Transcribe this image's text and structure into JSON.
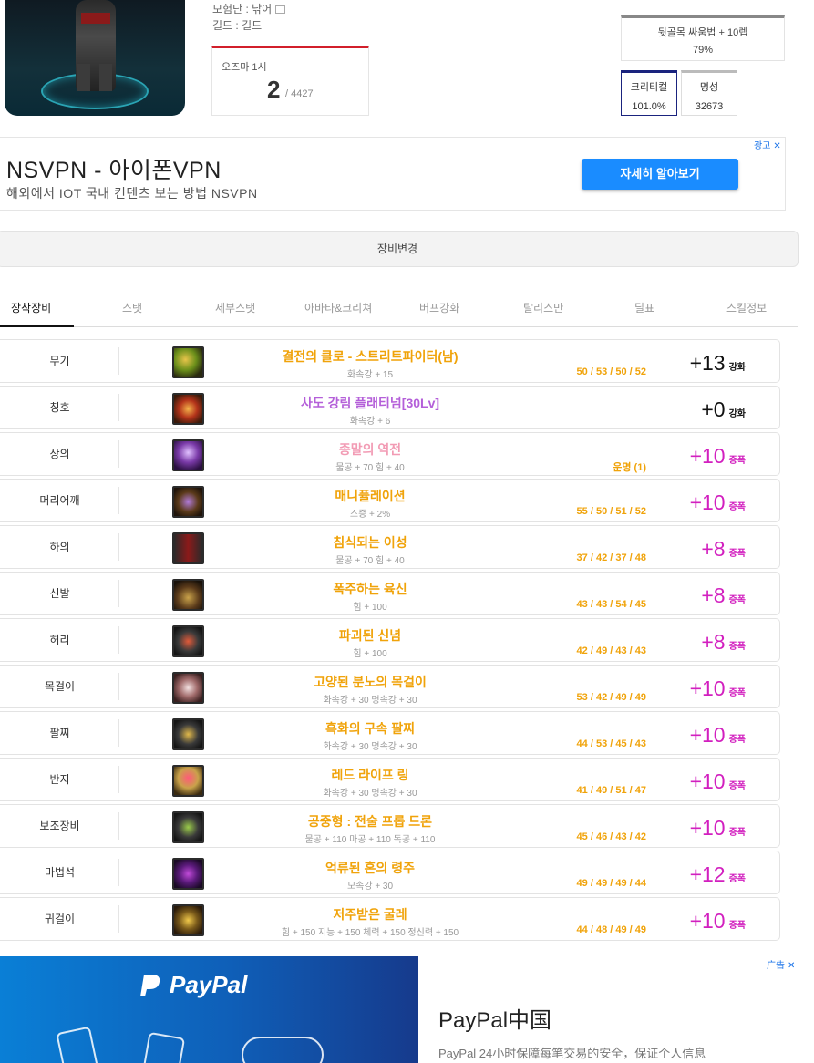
{
  "profile": {
    "adventure_label": "모험단 : 낚어",
    "guild_label": "길드 : 길드",
    "rank": {
      "label": "오즈마 1시",
      "value": "2",
      "total": "/ 4427"
    },
    "buff": {
      "title": "뒷골목 싸움법 + 10렙",
      "value": "79%"
    },
    "critical": {
      "title": "크리티컬",
      "value": "101.0%"
    },
    "fame": {
      "title": "명성",
      "value": "32673"
    }
  },
  "ad_top": {
    "title": "NSVPN - 아이폰VPN",
    "subtitle": "해외에서 IOT 국내 컨텐츠 보는 방법 NSVPN",
    "cta": "자세히 알아보기",
    "badge": "광고"
  },
  "change_button": "장비변경",
  "tabs": [
    "장착장비",
    "스탯",
    "세부스탯",
    "아바타&크리쳐",
    "버프강화",
    "탈리스만",
    "딜표",
    "스킬정보"
  ],
  "equipment": [
    {
      "slot": "무기",
      "name": "결전의 클로 - 스트리트파이터(남)",
      "stat": "화속강 + 15",
      "option": "50 / 53 / 50 / 52",
      "reinforce": "+13",
      "kind": "강화",
      "name_color": "#f0a30a",
      "type": "reinforce",
      "icon": "weapon-claw-icon"
    },
    {
      "slot": "칭호",
      "name": "사도 강림 플래티넘[30Lv]",
      "stat": "화속강 + 6",
      "option": "",
      "reinforce": "+0",
      "kind": "강화",
      "name_color": "#b45fd9",
      "type": "reinforce",
      "icon": "title-emblem-icon"
    },
    {
      "slot": "상의",
      "name": "종말의 역전",
      "stat": "물공 + 70 힘 + 40",
      "option": "운명 (1)",
      "reinforce": "+10",
      "kind": "증폭",
      "name_color": "#f29bb4",
      "type": "amp",
      "icon": "top-armor-icon"
    },
    {
      "slot": "머리어깨",
      "name": "매니퓰레이션",
      "stat": "스증 + 2%",
      "option": "55 / 50 / 51 / 52",
      "reinforce": "+10",
      "kind": "증폭",
      "name_color": "#f0a30a",
      "type": "amp",
      "icon": "shoulder-armor-icon"
    },
    {
      "slot": "하의",
      "name": "침식되는 이성",
      "stat": "물공 + 70 힘 + 40",
      "option": "37 / 42 / 37 / 48",
      "reinforce": "+8",
      "kind": "증폭",
      "name_color": "#f0a30a",
      "type": "amp",
      "icon": "pants-armor-icon"
    },
    {
      "slot": "신발",
      "name": "폭주하는 육신",
      "stat": "힘 + 100",
      "option": "43 / 43 / 54 / 45",
      "reinforce": "+8",
      "kind": "증폭",
      "name_color": "#f0a30a",
      "type": "amp",
      "icon": "shoes-armor-icon"
    },
    {
      "slot": "허리",
      "name": "파괴된 신념",
      "stat": "힘 + 100",
      "option": "42 / 49 / 43 / 43",
      "reinforce": "+8",
      "kind": "증폭",
      "name_color": "#f0a30a",
      "type": "amp",
      "icon": "belt-armor-icon"
    },
    {
      "slot": "목걸이",
      "name": "고양된 분노의 목걸이",
      "stat": "화속강 + 30 명속강 + 30",
      "option": "53 / 42 / 49 / 49",
      "reinforce": "+10",
      "kind": "증폭",
      "name_color": "#f0a30a",
      "type": "amp",
      "icon": "necklace-icon"
    },
    {
      "slot": "팔찌",
      "name": "흑화의 구속 팔찌",
      "stat": "화속강 + 30 명속강 + 30",
      "option": "44 / 53 / 45 / 43",
      "reinforce": "+10",
      "kind": "증폭",
      "name_color": "#f0a30a",
      "type": "amp",
      "icon": "bracelet-icon"
    },
    {
      "slot": "반지",
      "name": "레드 라이프 링",
      "stat": "화속강 + 30 명속강 + 30",
      "option": "41 / 49 / 51 / 47",
      "reinforce": "+10",
      "kind": "증폭",
      "name_color": "#f0a30a",
      "type": "amp",
      "icon": "ring-icon"
    },
    {
      "slot": "보조장비",
      "name": "공중형 : 전술 프롭 드론",
      "stat": "물공 + 110 마공 + 110 독공 + 110",
      "option": "45 / 46 / 43 / 42",
      "reinforce": "+10",
      "kind": "증폭",
      "name_color": "#f0a30a",
      "type": "amp",
      "icon": "drone-icon"
    },
    {
      "slot": "마법석",
      "name": "억류된 혼의 령주",
      "stat": "모속강 + 30",
      "option": "49 / 49 / 49 / 44",
      "reinforce": "+12",
      "kind": "증폭",
      "name_color": "#f0a30a",
      "type": "amp",
      "icon": "magic-stone-icon"
    },
    {
      "slot": "귀걸이",
      "name": "저주받은 굴레",
      "stat": "힘 + 150 지능 + 150 체력 + 150 정신력 + 150",
      "option": "44 / 48 / 49 / 49",
      "reinforce": "+10",
      "kind": "증폭",
      "name_color": "#f0a30a",
      "type": "amp",
      "icon": "earring-icon"
    }
  ],
  "ad_bottom": {
    "logo": "PayPal",
    "title": "PayPal中国",
    "subtitle": "PayPal 24小时保障每笔交易的安全，保证个人信息",
    "badge": "广告"
  },
  "colors": {
    "accent_red": "#d21f2b",
    "option_orange": "#f0a30a",
    "amp_magenta": "#d21fbf",
    "cta_blue": "#1a8cff",
    "critical_border": "#1a237e"
  }
}
